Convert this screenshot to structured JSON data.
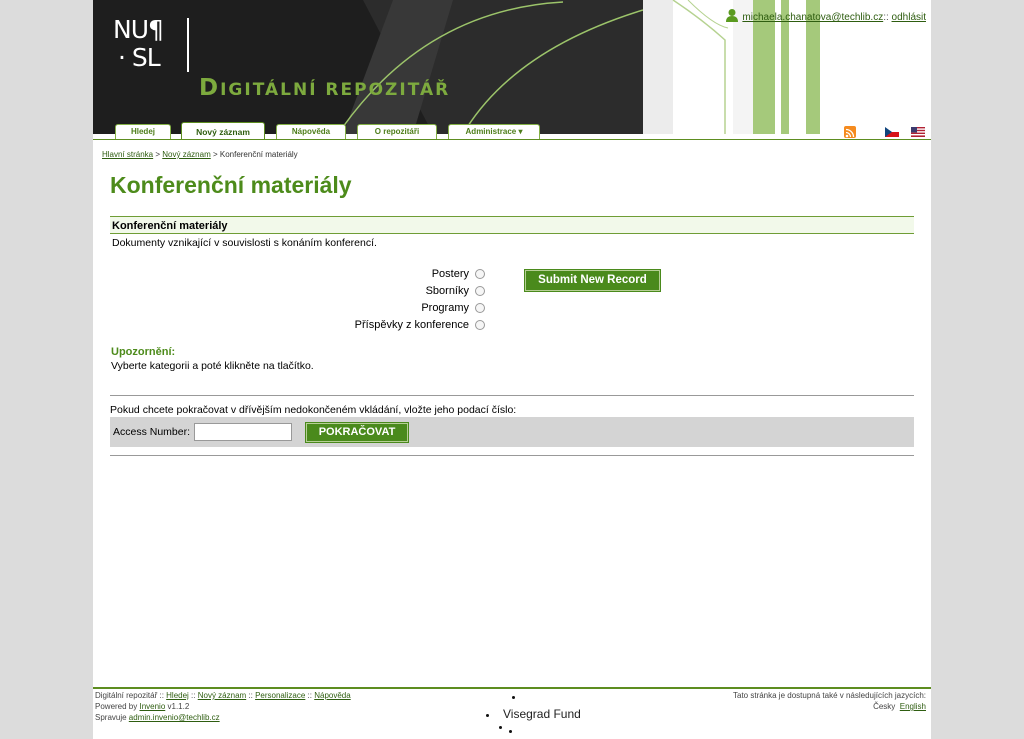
{
  "header": {
    "logo_line1": "NU¶",
    "logo_line2": "· SL",
    "site_title_first": "D",
    "site_title_rest": "IGITÁLNÍ REPOZITÁŘ",
    "user_email": "michaela.chanatova@techlib.cz",
    "user_separator": "::",
    "logout_label": "odhlásit",
    "tabs": [
      {
        "label": "Hledej"
      },
      {
        "label": "Nový záznam"
      },
      {
        "label": "Nápověda"
      },
      {
        "label": "O repozitáři"
      },
      {
        "label": "Administrace ▾"
      }
    ]
  },
  "breadcrumb": {
    "home": "Hlavní stránka",
    "sep1": " > ",
    "new_record": "Nový záznam",
    "sep2": " > ",
    "current": "Konferenční materiály"
  },
  "main": {
    "title": "Konferenční materiály",
    "section_title": "Konferenční materiály",
    "section_desc": "Dokumenty vznikající v souvislosti s konáním konferencí.",
    "categories": [
      {
        "label": "Postery"
      },
      {
        "label": "Sborníky"
      },
      {
        "label": "Programy"
      },
      {
        "label": "Příspěvky z konference"
      }
    ],
    "submit_label": "Submit New Record",
    "notice_title": "Upozornění:",
    "notice_text": "Vyberte kategorii a poté klikněte na tlačítko.",
    "continue_text": "Pokud chcete pokračovat v dřívějším nedokončeném vkládání, vložte jeho podací číslo:",
    "access_label": "Access Number:",
    "access_value": "",
    "continue_label": "POKRAČOVAT"
  },
  "footer": {
    "site_name": "Digitální repozitář",
    "sep": " :: ",
    "link_search": "Hledej",
    "link_new": "Nový záznam",
    "link_personal": "Personalizace",
    "link_help": "Nápověda",
    "powered_prefix": "Powered by ",
    "powered_link": "Invenio",
    "powered_version": " v1.1.2",
    "admin_prefix": "Spravuje ",
    "admin_email": "admin.invenio@techlib.cz",
    "lang_text": "Tato stránka je dostupná také v následujících jazycích:",
    "lang_current": "Česky",
    "lang_english": "English",
    "visegrad": "Visegrad Fund"
  },
  "colors": {
    "accent_green": "#4d8b1b",
    "button_green": "#4a8a1c",
    "header_dark": "#1e1e1e"
  },
  "icons": [
    "user-icon",
    "rss-icon",
    "flag-cz-icon",
    "flag-us-icon",
    "radio-icon"
  ]
}
